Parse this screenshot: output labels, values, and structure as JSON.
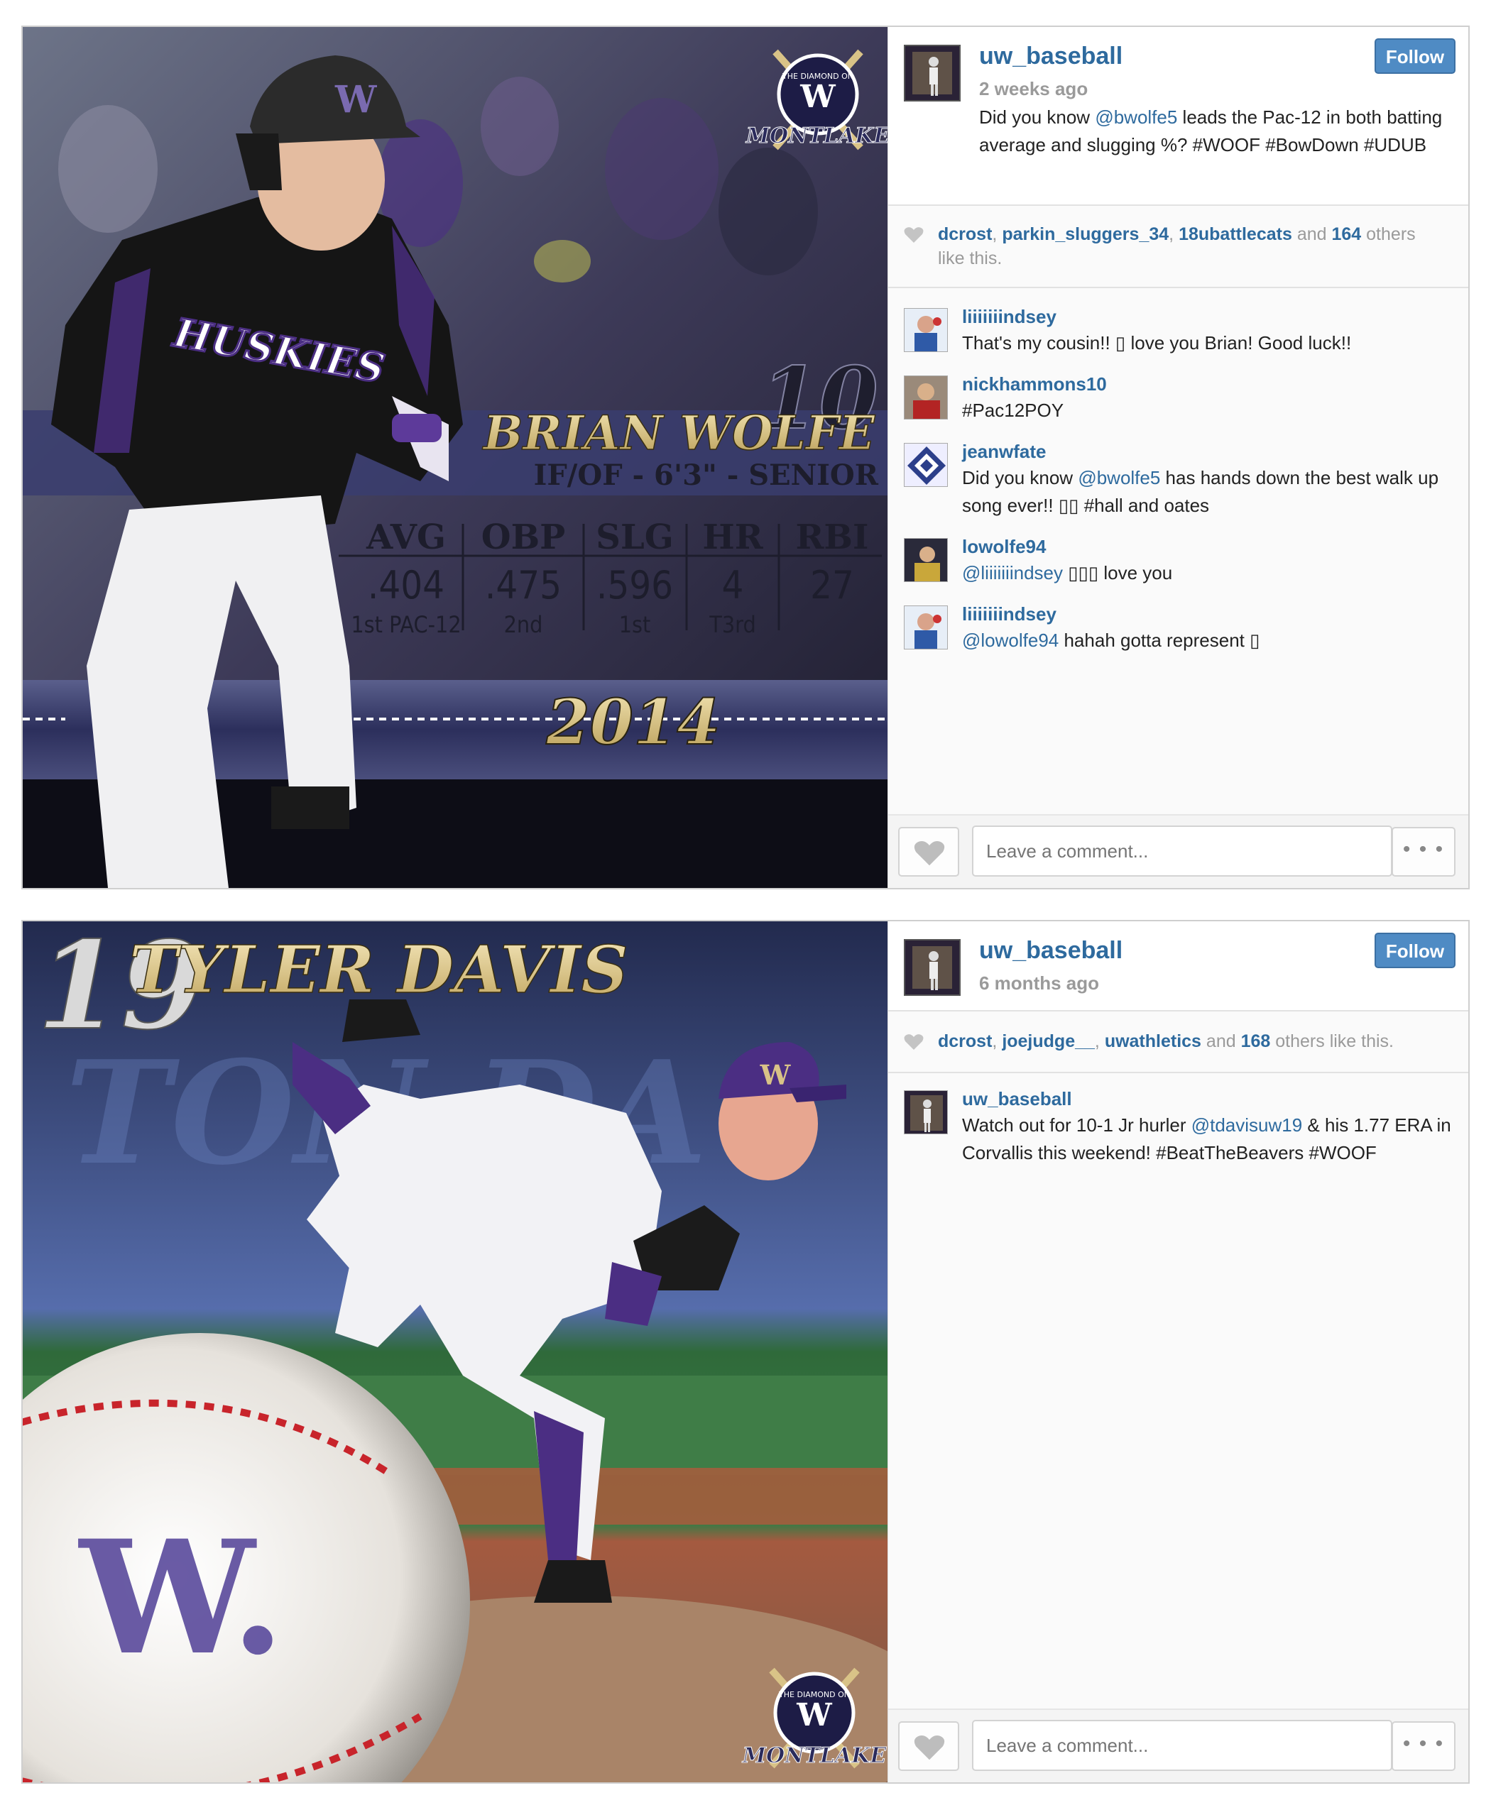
{
  "colors": {
    "link": "#2e6a9e",
    "follow_bg": "#4f8bc4",
    "uw_purple": "#4b2e83",
    "uw_gold": "#d8c78a"
  },
  "post1": {
    "image": {
      "badge_top": "THE DIAMOND ON",
      "badge_logo": "W",
      "badge_name": "MONTLAKE",
      "jersey_text": "HUSKIES",
      "helmet_logo": "W",
      "number": "10",
      "player_name": "BRIAN WOLFE",
      "player_info": "IF/OF - 6'3\" - SENIOR",
      "stats": [
        {
          "label": "AVG",
          "value": ".404",
          "rank": "1st PAC-12"
        },
        {
          "label": "OBP",
          "value": ".475",
          "rank": "2nd"
        },
        {
          "label": "SLG",
          "value": ".596",
          "rank": "1st"
        },
        {
          "label": "HR",
          "value": "4",
          "rank": "T3rd"
        },
        {
          "label": "RBI",
          "value": "27",
          "rank": ""
        }
      ],
      "year": "2014"
    },
    "username": "uw_baseball",
    "follow_label": "Follow",
    "time_ago": "2 weeks ago",
    "caption": {
      "pre": "Did you know ",
      "mention": "@bwolfe5",
      "post": " leads the Pac-12 in both batting average and slugging %? #WOOF #BowDown #UDUB"
    },
    "likes": {
      "user1": "dcrost",
      "user2": "parkin_sluggers_34",
      "user3": "18ubattlecats",
      "and": "and",
      "count": "164",
      "suffix": "others like this."
    },
    "comments": [
      {
        "user": "liiiiiiindsey",
        "mention": "",
        "text": "That's my cousin!! ▯ love you Brian! Good luck!!"
      },
      {
        "user": "nickhammons10",
        "mention": "",
        "text": "#Pac12POY"
      },
      {
        "user": "jeanwfate",
        "pre": "Did you know ",
        "mention": "@bwolfe5",
        "text": " has hands down the best walk up song ever!! ▯▯ #hall and oates"
      },
      {
        "user": "lowolfe94",
        "mention": "@liiiiiiindsey",
        "text": " ▯▯▯ love you"
      },
      {
        "user": "liiiiiiindsey",
        "mention": "@lowolfe94",
        "text": " hahah gotta represent ▯"
      }
    ],
    "comment_placeholder": "Leave a comment...",
    "more_label": "• • •"
  },
  "post2": {
    "image": {
      "number": "19",
      "player_name": "TYLER DAVIS",
      "bg_text": "TON DA",
      "cap_logo": "W",
      "ball_logo": "W.",
      "badge_top": "THE DIAMOND ON",
      "badge_logo": "W",
      "badge_name": "MONTLAKE"
    },
    "username": "uw_baseball",
    "follow_label": "Follow",
    "time_ago": "6 months ago",
    "likes": {
      "user1": "dcrost",
      "user2": "joejudge__",
      "user3": "uwathletics",
      "and": "and",
      "count": "168",
      "suffix": "others like this."
    },
    "comments": [
      {
        "user": "uw_baseball",
        "pre": "Watch out for 10-1 Jr hurler ",
        "mention": "@tdavisuw19",
        "text": " & his 1.77 ERA in Corvallis this weekend! #BeatTheBeavers #WOOF"
      }
    ],
    "comment_placeholder": "Leave a comment...",
    "more_label": "• • •"
  }
}
